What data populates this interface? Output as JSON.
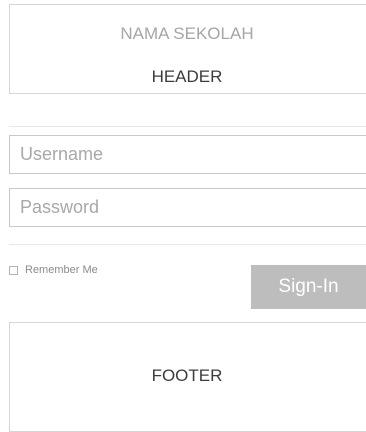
{
  "header": {
    "school_name": "NAMA SEKOLAH",
    "label": "HEADER"
  },
  "login": {
    "username_placeholder": "Username",
    "password_placeholder": "Password",
    "remember_label": "Remember Me",
    "remember_checked": false,
    "signin_label": "Sign-In"
  },
  "footer": {
    "label": "FOOTER"
  },
  "colors": {
    "signin_bg": "#bdbdbd",
    "border": "#c8c8c8",
    "placeholder": "#a8a8a8"
  }
}
